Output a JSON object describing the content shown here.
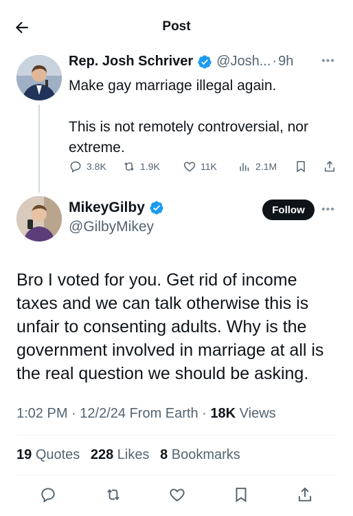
{
  "header": {
    "title": "Post",
    "back_icon": "arrow-left-icon"
  },
  "parent_tweet": {
    "name": "Rep. Josh Schriver",
    "handle": "@Josh...",
    "separator": "·",
    "time": "9h",
    "verified_color": "#1d9bf0",
    "text": "Make gay marriage illegal again.\n\nThis is not remotely controversial, nor extreme.",
    "actions": {
      "replies": "3.8K",
      "reposts": "1.9K",
      "likes": "11K",
      "views": "2.1M"
    }
  },
  "main_tweet": {
    "name": "MikeyGilby",
    "handle": "@GilbyMikey",
    "follow_label": "Follow",
    "text": "Bro I voted for you. Get rid of income taxes and we can talk otherwise this is unfair to consenting adults. Why is the government involved in marriage at all is the real question we should be asking.",
    "meta": {
      "time": "1:02 PM",
      "date": "12/2/24",
      "source": "From Earth",
      "separator": "·",
      "views_count": "18K",
      "views_label": "Views"
    },
    "stats": {
      "quotes_count": "19",
      "quotes_label": "Quotes",
      "likes_count": "228",
      "likes_label": "Likes",
      "bookmarks_count": "8",
      "bookmarks_label": "Bookmarks"
    }
  },
  "colors": {
    "text": "#0f1419",
    "secondary": "#536471",
    "accent": "#1d9bf0"
  }
}
